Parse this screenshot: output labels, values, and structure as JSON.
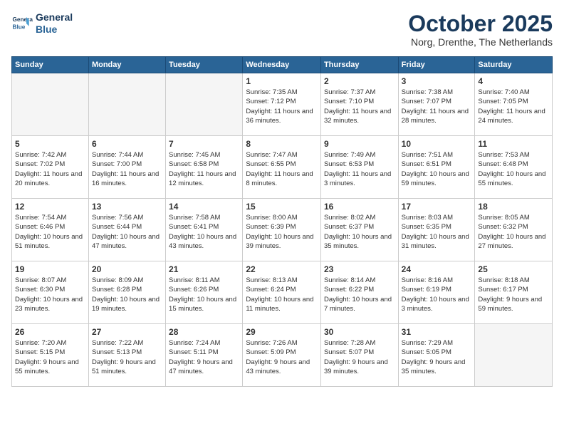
{
  "logo": {
    "line1": "General",
    "line2": "Blue"
  },
  "title": "October 2025",
  "location": "Norg, Drenthe, The Netherlands",
  "weekdays": [
    "Sunday",
    "Monday",
    "Tuesday",
    "Wednesday",
    "Thursday",
    "Friday",
    "Saturday"
  ],
  "weeks": [
    [
      {
        "day": "",
        "info": ""
      },
      {
        "day": "",
        "info": ""
      },
      {
        "day": "",
        "info": ""
      },
      {
        "day": "1",
        "info": "Sunrise: 7:35 AM\nSunset: 7:12 PM\nDaylight: 11 hours\nand 36 minutes."
      },
      {
        "day": "2",
        "info": "Sunrise: 7:37 AM\nSunset: 7:10 PM\nDaylight: 11 hours\nand 32 minutes."
      },
      {
        "day": "3",
        "info": "Sunrise: 7:38 AM\nSunset: 7:07 PM\nDaylight: 11 hours\nand 28 minutes."
      },
      {
        "day": "4",
        "info": "Sunrise: 7:40 AM\nSunset: 7:05 PM\nDaylight: 11 hours\nand 24 minutes."
      }
    ],
    [
      {
        "day": "5",
        "info": "Sunrise: 7:42 AM\nSunset: 7:02 PM\nDaylight: 11 hours\nand 20 minutes."
      },
      {
        "day": "6",
        "info": "Sunrise: 7:44 AM\nSunset: 7:00 PM\nDaylight: 11 hours\nand 16 minutes."
      },
      {
        "day": "7",
        "info": "Sunrise: 7:45 AM\nSunset: 6:58 PM\nDaylight: 11 hours\nand 12 minutes."
      },
      {
        "day": "8",
        "info": "Sunrise: 7:47 AM\nSunset: 6:55 PM\nDaylight: 11 hours\nand 8 minutes."
      },
      {
        "day": "9",
        "info": "Sunrise: 7:49 AM\nSunset: 6:53 PM\nDaylight: 11 hours\nand 3 minutes."
      },
      {
        "day": "10",
        "info": "Sunrise: 7:51 AM\nSunset: 6:51 PM\nDaylight: 10 hours\nand 59 minutes."
      },
      {
        "day": "11",
        "info": "Sunrise: 7:53 AM\nSunset: 6:48 PM\nDaylight: 10 hours\nand 55 minutes."
      }
    ],
    [
      {
        "day": "12",
        "info": "Sunrise: 7:54 AM\nSunset: 6:46 PM\nDaylight: 10 hours\nand 51 minutes."
      },
      {
        "day": "13",
        "info": "Sunrise: 7:56 AM\nSunset: 6:44 PM\nDaylight: 10 hours\nand 47 minutes."
      },
      {
        "day": "14",
        "info": "Sunrise: 7:58 AM\nSunset: 6:41 PM\nDaylight: 10 hours\nand 43 minutes."
      },
      {
        "day": "15",
        "info": "Sunrise: 8:00 AM\nSunset: 6:39 PM\nDaylight: 10 hours\nand 39 minutes."
      },
      {
        "day": "16",
        "info": "Sunrise: 8:02 AM\nSunset: 6:37 PM\nDaylight: 10 hours\nand 35 minutes."
      },
      {
        "day": "17",
        "info": "Sunrise: 8:03 AM\nSunset: 6:35 PM\nDaylight: 10 hours\nand 31 minutes."
      },
      {
        "day": "18",
        "info": "Sunrise: 8:05 AM\nSunset: 6:32 PM\nDaylight: 10 hours\nand 27 minutes."
      }
    ],
    [
      {
        "day": "19",
        "info": "Sunrise: 8:07 AM\nSunset: 6:30 PM\nDaylight: 10 hours\nand 23 minutes."
      },
      {
        "day": "20",
        "info": "Sunrise: 8:09 AM\nSunset: 6:28 PM\nDaylight: 10 hours\nand 19 minutes."
      },
      {
        "day": "21",
        "info": "Sunrise: 8:11 AM\nSunset: 6:26 PM\nDaylight: 10 hours\nand 15 minutes."
      },
      {
        "day": "22",
        "info": "Sunrise: 8:13 AM\nSunset: 6:24 PM\nDaylight: 10 hours\nand 11 minutes."
      },
      {
        "day": "23",
        "info": "Sunrise: 8:14 AM\nSunset: 6:22 PM\nDaylight: 10 hours\nand 7 minutes."
      },
      {
        "day": "24",
        "info": "Sunrise: 8:16 AM\nSunset: 6:19 PM\nDaylight: 10 hours\nand 3 minutes."
      },
      {
        "day": "25",
        "info": "Sunrise: 8:18 AM\nSunset: 6:17 PM\nDaylight: 9 hours\nand 59 minutes."
      }
    ],
    [
      {
        "day": "26",
        "info": "Sunrise: 7:20 AM\nSunset: 5:15 PM\nDaylight: 9 hours\nand 55 minutes."
      },
      {
        "day": "27",
        "info": "Sunrise: 7:22 AM\nSunset: 5:13 PM\nDaylight: 9 hours\nand 51 minutes."
      },
      {
        "day": "28",
        "info": "Sunrise: 7:24 AM\nSunset: 5:11 PM\nDaylight: 9 hours\nand 47 minutes."
      },
      {
        "day": "29",
        "info": "Sunrise: 7:26 AM\nSunset: 5:09 PM\nDaylight: 9 hours\nand 43 minutes."
      },
      {
        "day": "30",
        "info": "Sunrise: 7:28 AM\nSunset: 5:07 PM\nDaylight: 9 hours\nand 39 minutes."
      },
      {
        "day": "31",
        "info": "Sunrise: 7:29 AM\nSunset: 5:05 PM\nDaylight: 9 hours\nand 35 minutes."
      },
      {
        "day": "",
        "info": ""
      }
    ]
  ]
}
